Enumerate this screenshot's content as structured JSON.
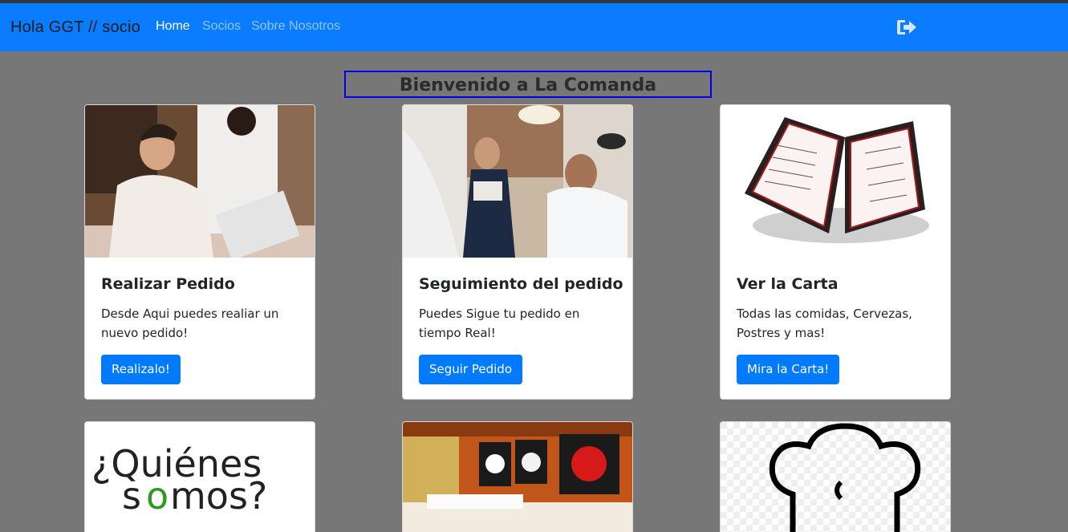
{
  "navbar": {
    "brand": "Hola GGT // socio",
    "links": [
      "Home",
      "Socios",
      "Sobre Nosotros"
    ],
    "logout_icon": "sign-out-icon"
  },
  "main": {
    "heading": "Bienvenido a La Comanda",
    "cards": [
      {
        "title": "Realizar Pedido",
        "text": "Desde Aqui puedes realiar un nuevo pedido!",
        "button": "Realizalo!"
      },
      {
        "title": "Seguimiento del pedido",
        "text": "Puedes Sigue tu pedido en tiempo Real!",
        "button": "Seguir Pedido"
      },
      {
        "title": "Ver la Carta",
        "text": "Todas las comidas, Cervezas, Postres y mas!",
        "button": "Mira la Carta!"
      }
    ],
    "bottom_cards": {
      "quienes_top": "¿Quiénes",
      "quienes_bottom_s": "s",
      "quienes_bottom_o": "o",
      "quienes_bottom_rest": "mos?"
    }
  },
  "colors": {
    "navbar": "#0a7cff",
    "button": "#007bff",
    "background": "#777777"
  }
}
